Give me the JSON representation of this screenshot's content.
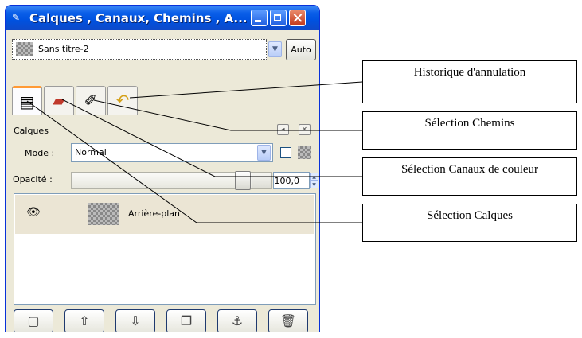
{
  "window": {
    "title": "Calques , Canaux, Chemins , A...",
    "image_select": "Sans titre-2",
    "auto_button": "Auto"
  },
  "tabs": [
    {
      "icon": "layers-tab-icon",
      "glyph": "▤"
    },
    {
      "icon": "channels-tab-icon",
      "glyph": "▰"
    },
    {
      "icon": "paths-tab-icon",
      "glyph": "✐"
    },
    {
      "icon": "undo-history-tab-icon",
      "glyph": "↶"
    }
  ],
  "panel": {
    "title": "Calques",
    "mode_label": "Mode :",
    "mode_value": "Normal",
    "opacity_label": "Opacité :",
    "opacity_value": "100,0",
    "opacity_level": 0.9
  },
  "layers": [
    {
      "name": "Arrière-plan",
      "visible": true
    }
  ],
  "bottom_buttons": [
    {
      "icon": "new-layer-icon",
      "glyph": "▢"
    },
    {
      "icon": "raise-layer-icon",
      "glyph": "⇧"
    },
    {
      "icon": "lower-layer-icon",
      "glyph": "⇩"
    },
    {
      "icon": "duplicate-layer-icon",
      "glyph": "❐"
    },
    {
      "icon": "anchor-layer-icon",
      "glyph": "⚓"
    },
    {
      "icon": "delete-layer-icon",
      "glyph": "🗑"
    }
  ],
  "annotations": [
    "Historique d'annulation",
    "Sélection Chemins",
    "Sélection Canaux de couleur",
    "Sélection Calques"
  ],
  "colors": {
    "titlebar": "#0052e0",
    "active_tab_accent": "#ff9a35",
    "window_bg": "#ece9d8"
  }
}
